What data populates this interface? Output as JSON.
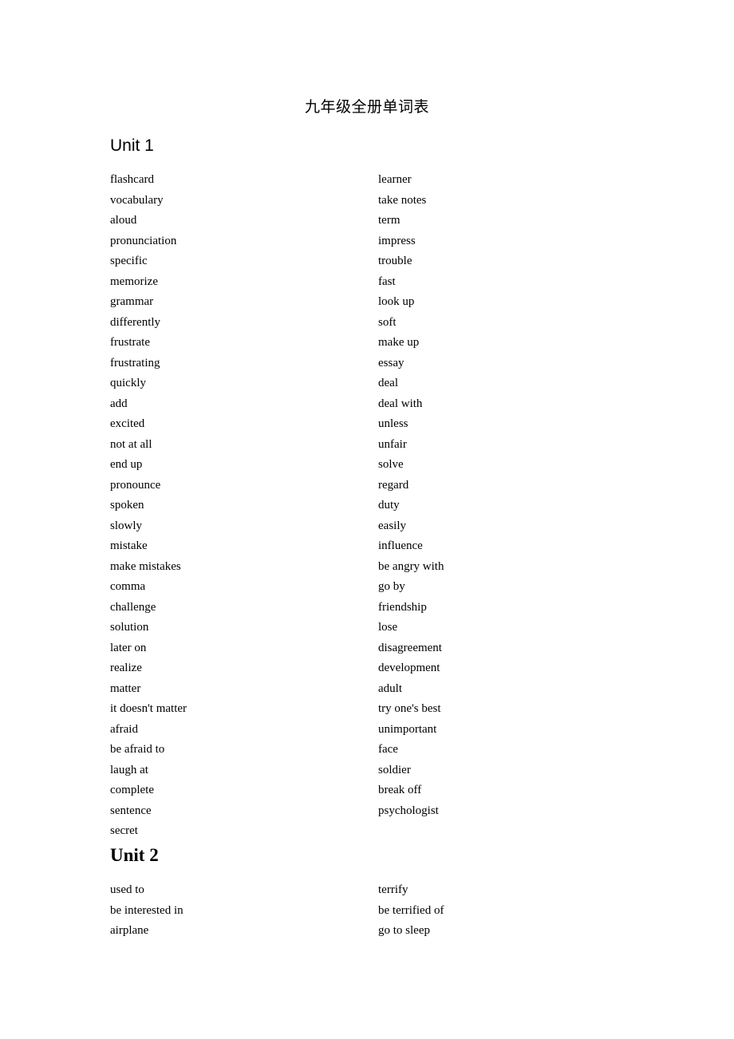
{
  "document": {
    "title": "九年级全册单词表"
  },
  "units": [
    {
      "heading": "Unit 1",
      "left_column": [
        "flashcard",
        "vocabulary",
        "aloud",
        "pronunciation",
        "specific",
        "memorize",
        "grammar",
        "differently",
        "frustrate",
        "frustrating",
        "quickly",
        "add",
        "excited",
        "not at all",
        "end up",
        "pronounce",
        "spoken",
        "slowly",
        "mistake",
        "make mistakes",
        "comma",
        "challenge",
        "solution",
        "later on",
        "realize",
        "matter",
        "it doesn't matter",
        "afraid",
        "be afraid to",
        "laugh at",
        "complete",
        "sentence",
        "secret"
      ],
      "right_column": [
        "learner",
        "take notes",
        "term",
        "impress",
        "trouble",
        "fast",
        "look up",
        "soft",
        "make up",
        "essay",
        "deal",
        "deal with",
        "unless",
        "unfair",
        "solve",
        "regard",
        "duty",
        "easily",
        "influence",
        "be angry with",
        "go by",
        "friendship",
        "lose",
        "disagreement",
        "development",
        "adult",
        "try one's best",
        "unimportant",
        "face",
        "soldier",
        "break off",
        "psychologist"
      ]
    },
    {
      "heading": "Unit 2",
      "left_column": [
        "used to",
        "be interested in",
        "airplane"
      ],
      "right_column": [
        "terrify",
        "be terrified of",
        "go to sleep"
      ]
    }
  ]
}
